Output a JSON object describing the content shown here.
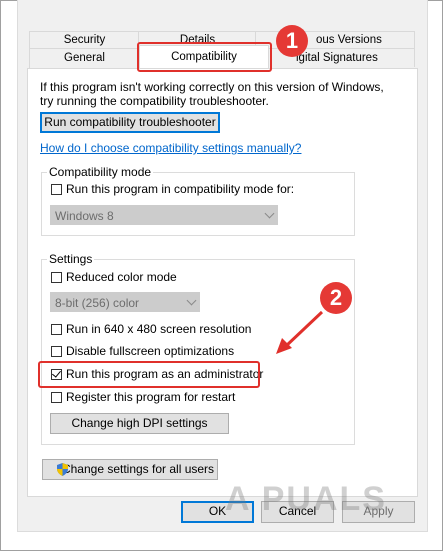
{
  "tabs": {
    "row1": [
      "Security",
      "Details",
      "ous Versions"
    ],
    "row2": [
      "General",
      "Compatibility",
      "igital Signatures"
    ]
  },
  "intro": {
    "line1": "If this program isn't working correctly on this version of Windows,",
    "line2": "try running the compatibility troubleshooter.",
    "troubleshooter_button": "Run compatibility troubleshooter",
    "manual_link": "How do I choose compatibility settings manually?"
  },
  "compat_mode": {
    "title": "Compatibility mode",
    "checkbox_label": "Run this program in compatibility mode for:",
    "checked": false,
    "os_select": "Windows 8"
  },
  "settings": {
    "title": "Settings",
    "reduced_color": "Reduced color mode",
    "color_select": "8-bit (256) color",
    "res_640": "Run in 640 x 480 screen resolution",
    "disable_fullscreen": "Disable fullscreen optimizations",
    "run_admin": "Run this program as an administrator",
    "register_restart": "Register this program for restart",
    "dpi_button": "Change high DPI settings",
    "checked": {
      "reduced_color": false,
      "res_640": false,
      "disable_fullscreen": false,
      "run_admin": true,
      "register_restart": false
    }
  },
  "all_users_button": "Change settings for all users",
  "footer": {
    "ok": "OK",
    "cancel": "Cancel",
    "apply": "Apply"
  },
  "annotations": {
    "marker1": "1",
    "marker2": "2",
    "accent": "#e0302b"
  },
  "watermark": "A PUALS"
}
